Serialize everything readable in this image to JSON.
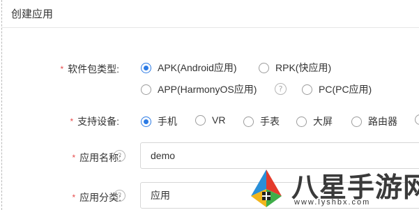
{
  "page": {
    "title": "创建应用"
  },
  "form": {
    "software_type": {
      "label": "软件包类型:",
      "options": [
        {
          "label": "APK(Android应用)",
          "checked": true
        },
        {
          "label": "RPK(快应用)",
          "checked": false
        },
        {
          "label": "APP(HarmonyOS应用)",
          "checked": false
        },
        {
          "label": "PC(PC应用)",
          "checked": false
        }
      ],
      "help_icon": "question-icon"
    },
    "device": {
      "label": "支持设备:",
      "options": [
        {
          "label": "手机",
          "checked": true
        },
        {
          "label": "VR",
          "checked": false
        },
        {
          "label": "手表",
          "checked": false
        },
        {
          "label": "大屏",
          "checked": false
        },
        {
          "label": "路由器",
          "checked": false
        }
      ]
    },
    "app_name": {
      "label": "应用名称:",
      "value": "demo",
      "help_icon": "question-icon"
    },
    "app_category": {
      "label": "应用分类:",
      "value": "应用",
      "help_icon": "question-icon"
    },
    "required_mark": "*"
  },
  "watermark": {
    "brand": "八星手游网",
    "url": "www.lyshbx.com"
  },
  "colors": {
    "accent": "#2c7be5",
    "required": "#e64b4b",
    "border": "#d6d6d6"
  }
}
